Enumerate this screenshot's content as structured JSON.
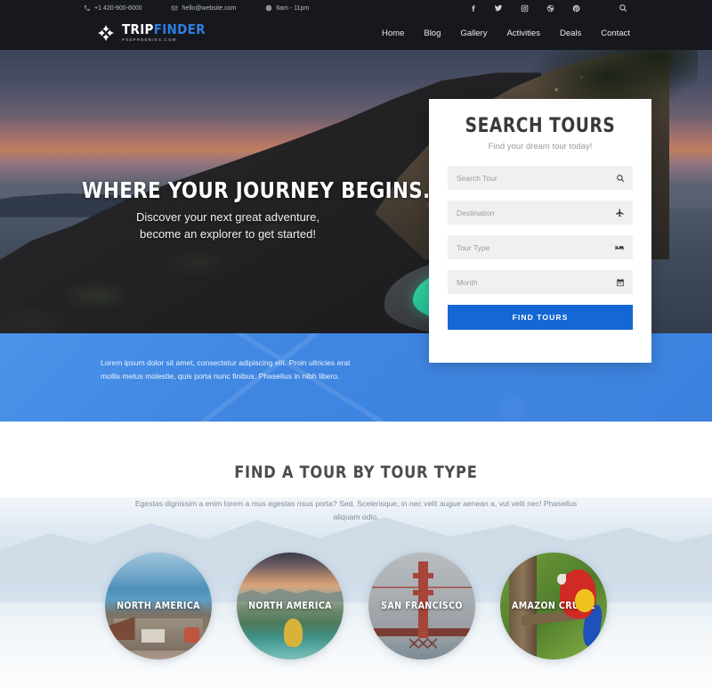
{
  "topbar": {
    "phone": "+1 420-900-6000",
    "email": "hello@website.com",
    "hours": "6am - 11pm",
    "social": [
      "facebook-icon",
      "twitter-icon",
      "instagram-icon",
      "dribbble-icon",
      "pinterest-icon",
      "search-icon"
    ]
  },
  "brand": {
    "name_primary": "TRIP",
    "name_secondary": "FINDER",
    "tagline": "PSDFREEBIES.COM",
    "accent_color": "#2f7de1"
  },
  "nav": {
    "items": [
      {
        "label": "Home"
      },
      {
        "label": "Blog"
      },
      {
        "label": "Gallery"
      },
      {
        "label": "Activities"
      },
      {
        "label": "Deals"
      },
      {
        "label": "Contact"
      }
    ]
  },
  "hero": {
    "headline": "WHERE YOUR JOURNEY BEGINS.",
    "subline_1": "Discover your next great adventure,",
    "subline_2": "become an explorer to get started!"
  },
  "search_card": {
    "title": "SEARCH TOURS",
    "subtitle": "Find your dream tour today!",
    "fields": [
      {
        "placeholder": "Search Tour",
        "value": "",
        "icon": "search-icon"
      },
      {
        "placeholder": "Destination",
        "value": "",
        "icon": "plane-icon"
      },
      {
        "placeholder": "Tour Type",
        "value": "",
        "icon": "bed-icon"
      },
      {
        "placeholder": "Month",
        "value": "",
        "icon": "calendar-icon"
      }
    ],
    "submit_label": "FIND TOURS",
    "submit_color": "#1467d4"
  },
  "band": {
    "text": "Lorem ipsum dolor sit amet, consectetur adipiscing elit. Proin ultricies erat mollis metus molestie, quis porta nunc finibus. Phasellus in nibh libero.",
    "background_color": "#3f86e2"
  },
  "tour_types": {
    "heading": "FIND A TOUR BY TOUR TYPE",
    "subheading": "Egestas dignissim a enim lorem a mus egestas risus porta? Sed. Scelerisque, in nec velit augue aenean a, vut velit nec! Phasellus aliquam odio.",
    "cards": [
      {
        "label": "NORTH AMERICA"
      },
      {
        "label": "NORTH AMERICA"
      },
      {
        "label": "SAN FRANCISCO"
      },
      {
        "label": "AMAZON CRUISE"
      }
    ]
  }
}
